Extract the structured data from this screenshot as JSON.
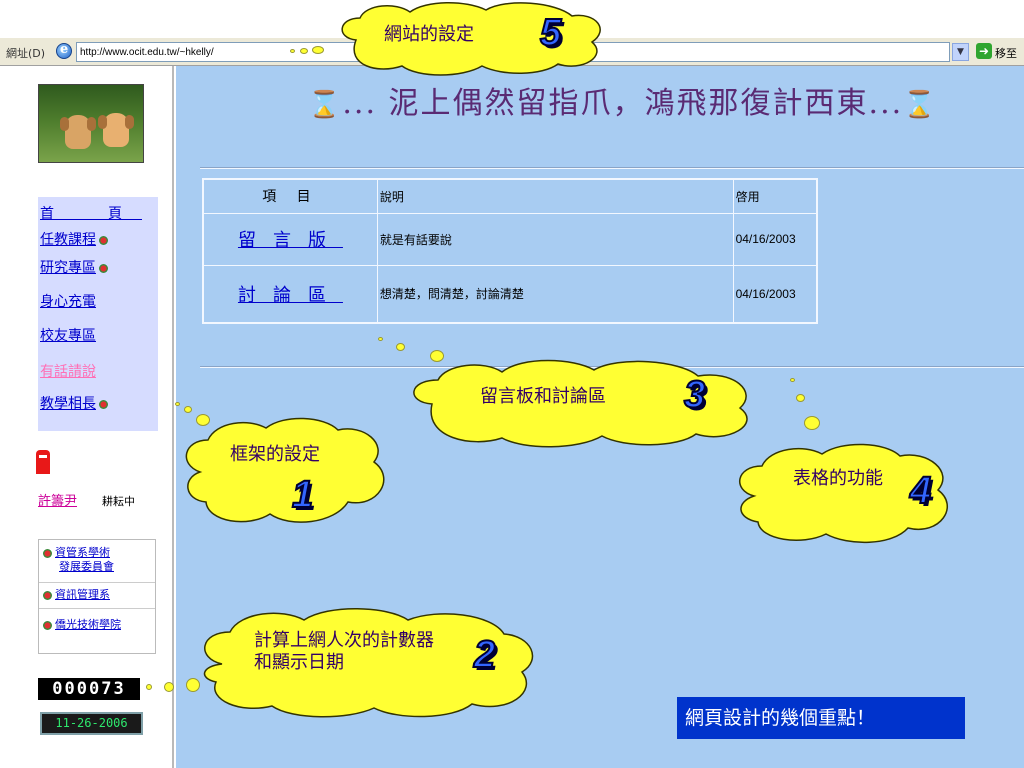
{
  "address_bar": {
    "label": "網址(D)",
    "url": "http://www.ocit.edu.tw/~hkelly/",
    "go_label": "移至"
  },
  "left_frame": {
    "nav_items": [
      {
        "label": "首　頁",
        "flower": false,
        "highlight": false
      },
      {
        "label": "任教課程",
        "flower": true,
        "highlight": false
      },
      {
        "label": "研究專區",
        "flower": true,
        "highlight": false
      },
      {
        "label": "身心充電",
        "flower": false,
        "highlight": false
      },
      {
        "label": "校友專區",
        "flower": false,
        "highlight": false
      },
      {
        "label": "有話請說",
        "flower": false,
        "highlight": true
      },
      {
        "label": "教學相長",
        "flower": true,
        "highlight": false
      }
    ],
    "author": {
      "name": "許籌尹",
      "suffix": "耕耘中"
    },
    "sub_links": [
      {
        "lines": [
          "資管系學術",
          "發展委員會"
        ]
      },
      {
        "lines": [
          "資訊管理系"
        ]
      },
      {
        "lines": [
          "僑光技術學院"
        ]
      }
    ],
    "counter": "000073",
    "date": "11-26-2006"
  },
  "main_frame": {
    "marquee": "泥上偶然留指爪，鴻飛那復計西東",
    "marquee_dots": "...",
    "table": {
      "headers": [
        "項 目",
        "說明",
        "啓用"
      ],
      "rows": [
        {
          "item": "留言版",
          "desc": "就是有話要說",
          "date": "04/16/2003"
        },
        {
          "item": "討論區",
          "desc": "想清楚，問清楚，討論清楚",
          "date": "04/16/2003"
        }
      ]
    },
    "caption": "網頁設計的幾個重點！"
  },
  "callouts": [
    {
      "text": "網站的設定",
      "number": "5"
    },
    {
      "text": "留言板和討論區",
      "number": "3"
    },
    {
      "text": "框架的設定",
      "number": "1"
    },
    {
      "text": "表格的功能",
      "number": "4"
    },
    {
      "text": "計算上網人次的計數器和顯示日期",
      "number": "2"
    }
  ],
  "colors": {
    "main_bg": "#a8ccf2",
    "nav_panel_bg": "#d6dcff",
    "callout_fill": "#ffff33",
    "caption_bg": "#0033cc",
    "number_blue": "#3366ff"
  }
}
